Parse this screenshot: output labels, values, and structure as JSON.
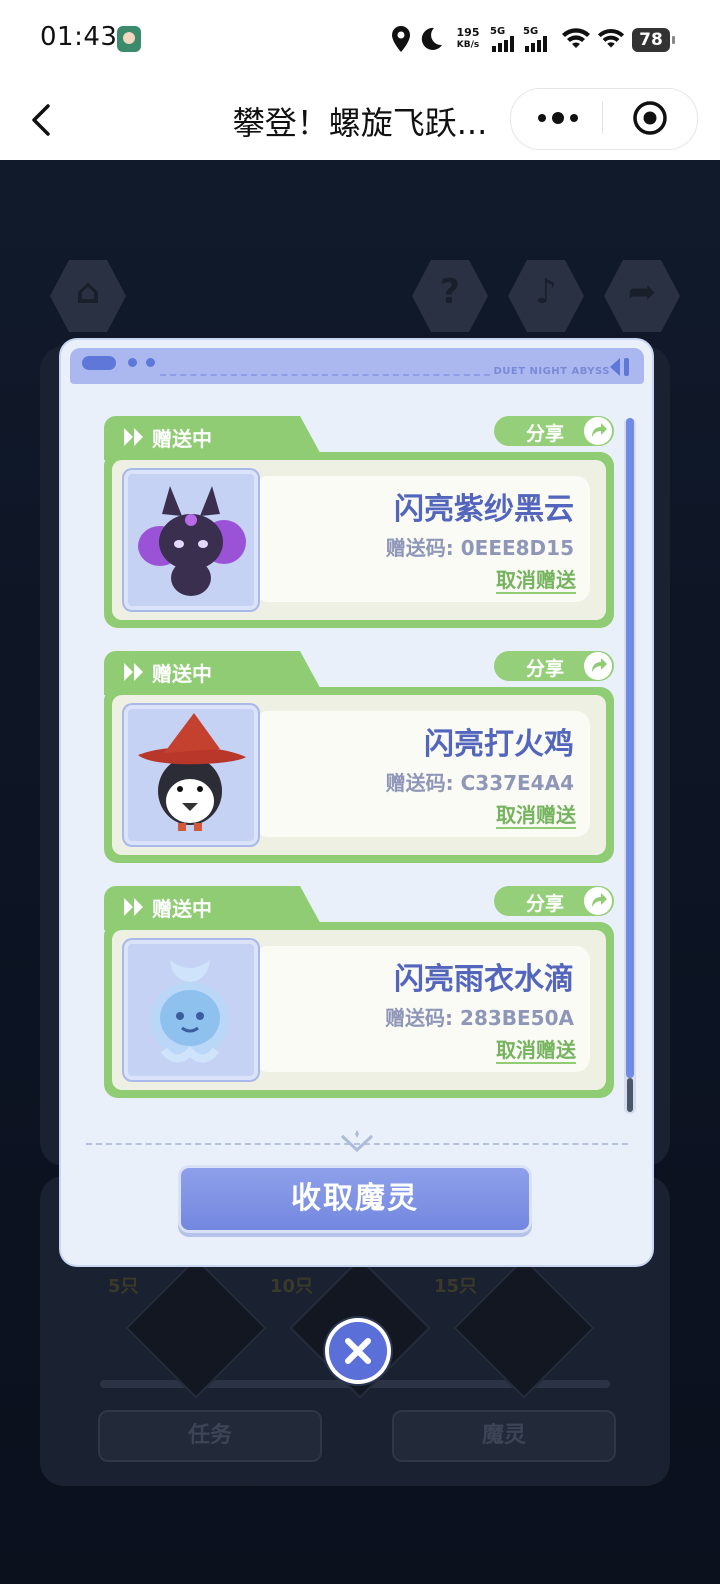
{
  "status_bar": {
    "time": "01:43",
    "net_speed_value": "195",
    "net_speed_unit": "KB/s",
    "sim1": "5G",
    "sim2": "5G",
    "battery": "78"
  },
  "header": {
    "title": "攀登！螺旋飞跃..."
  },
  "game_background": {
    "badges": [
      "5只",
      "10只",
      "15只"
    ],
    "tabs": [
      "任务",
      "魔灵"
    ]
  },
  "modal": {
    "brand": "DUET NIGHT ABYSS",
    "cards": [
      {
        "status": "赠送中",
        "share_label": "分享",
        "name": "闪亮紫纱黑云",
        "gift_code_label": "赠送码: ",
        "gift_code": "0EEE8D15",
        "cancel_label": "取消赠送",
        "pet_icon": "purple-cloud-cat-icon"
      },
      {
        "status": "赠送中",
        "share_label": "分享",
        "name": "闪亮打火鸡",
        "gift_code_label": "赠送码: ",
        "gift_code": "C337E4A4",
        "cancel_label": "取消赠送",
        "pet_icon": "witch-hat-bird-icon"
      },
      {
        "status": "赠送中",
        "share_label": "分享",
        "name": "闪亮雨衣水滴",
        "gift_code_label": "赠送码: ",
        "gift_code": "283BE50A",
        "cancel_label": "取消赠送",
        "pet_icon": "raincoat-droplet-icon"
      }
    ],
    "collect_button": "收取魔灵"
  },
  "colors": {
    "accent_blue": "#7387e0",
    "card_green": "#8fcc74",
    "name_blue": "#5465bd"
  }
}
